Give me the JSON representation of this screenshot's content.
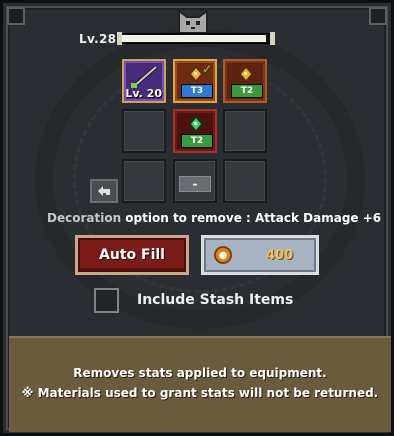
{
  "header": {
    "level_label": "Lv.28",
    "xp_progress": 0.97
  },
  "slots": {
    "equipped_level": "Lv. 20",
    "tier_3": "T3",
    "tier_2a": "T2",
    "tier_2b": "T2"
  },
  "decoration": {
    "option_label": "Decoration",
    "option_text": "option to remove : Attack Damage +6"
  },
  "buttons": {
    "auto_fill": "Auto Fill",
    "cost": "400",
    "minus": "-"
  },
  "stash": {
    "label": "Include Stash Items"
  },
  "info": {
    "line1": "Removes stats applied to equipment.",
    "line2": "※ Materials used to grant stats will not be returned."
  },
  "colors": {
    "auto_fill_bg": "#7a1c18",
    "cost_bg": "#a7b3c2",
    "tier3": "#2f7bd4",
    "tier2": "#3a9a3c",
    "info_bg": "#6a5a3e"
  }
}
